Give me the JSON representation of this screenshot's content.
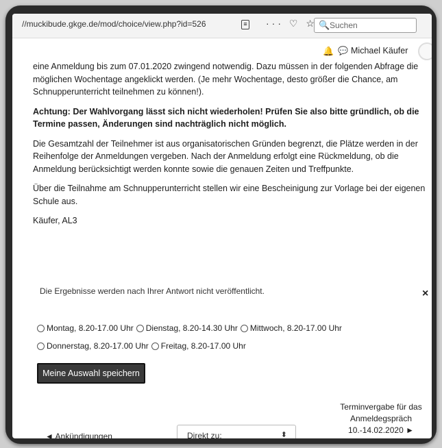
{
  "browser": {
    "url": "//muckibude.gkge.de/mod/choice/view.php?id=526",
    "toolbar_icons": "··· ♡ ☆",
    "search_placeholder": "Suchen"
  },
  "header": {
    "user_name": "Michael Käufer"
  },
  "content": {
    "p1": "eine Anmeldung bis zum 07.01.2020 zwingend notwendig. Dazu müssen in der folgenden Abfrage die möglichen Wochentage angeklickt werden. (Je mehr Wochentage, desto größer die Chance, am Schnupperunterricht teilnehmen zu können!).",
    "p2": "Achtung: Der Wahlvorgang lässt sich nicht wiederholen! Prüfen Sie also bitte gründlich, ob die Termine passen, Änderungen sind nachträglich nicht möglich.",
    "p3": "Die Gesamtzahl der Teilnehmer ist aus organisatorischen Gründen begrenzt, die Plätze werden in der Reihenfolge der Anmeldungen vergeben. Nach der Anmeldung erfolgt eine Rückmeldung, ob die Anmeldung berücksichtigt werden konnte sowie die genauen Zeiten und Treffpunkte.",
    "p4": "Über die Teilnahme am Schnupperunterricht stellen wir eine Bescheinigung zur Vorlage bei der eigenen Schule aus.",
    "p5": "Käufer, AL3"
  },
  "notice": {
    "text": "Die Ergebnisse werden nach Ihrer Antwort nicht veröffentlicht.",
    "close": "×"
  },
  "options": [
    "Montag, 8.20-17.00 Uhr",
    "Dienstag, 8.20-14.30 Uhr",
    "Mittwoch, 8.20-17.00 Uhr",
    "Donnerstag, 8.20-17.00 Uhr",
    "Freitag, 8.20-17.00 Uhr"
  ],
  "save_button": "Meine Auswahl speichern",
  "footer": {
    "prev_link": "◄ Ankündigungen",
    "jump_label": "Direkt zu:",
    "next_link": "Terminvergabe für das Anmeldegspräch 10.-14.02.2020 ►"
  }
}
